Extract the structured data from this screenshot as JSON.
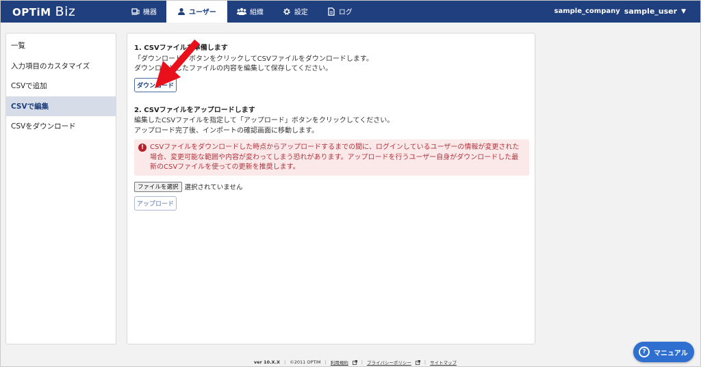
{
  "header": {
    "logo_brand": "OPTiM",
    "logo_product": "Biz",
    "nav": [
      {
        "label": "機器",
        "icon": "device-icon"
      },
      {
        "label": "ユーザー",
        "icon": "user-icon"
      },
      {
        "label": "組織",
        "icon": "organization-icon"
      },
      {
        "label": "設定",
        "icon": "gear-icon"
      },
      {
        "label": "ログ",
        "icon": "log-document-icon"
      }
    ],
    "active_nav": "ユーザー",
    "company": "sample_company",
    "user": "sample_user",
    "colors": {
      "header_bg": "#1f3f7e",
      "accent": "#1f3f7e"
    }
  },
  "sidebar": {
    "items": [
      {
        "label": "一覧"
      },
      {
        "label": "入力項目のカスタマイズ"
      },
      {
        "label": "CSVで追加"
      },
      {
        "label": "CSVで編集"
      },
      {
        "label": "CSVをダウンロード"
      }
    ],
    "active": "CSVで編集"
  },
  "main": {
    "step1": {
      "title": "1. CSVファイルを準備します",
      "line1": "「ダウンロード」ボタンをクリックしてCSVファイルをダウンロードします。",
      "line2": "ダウンロードしたファイルの内容を編集して保存してください。",
      "button": "ダウンロード"
    },
    "step2": {
      "title": "2. CSVファイルをアップロードします",
      "line1": "編集したCSVファイルを指定して「アップロード」ボタンをクリックしてください。",
      "line2": "アップロード完了後、インポートの確認画面に移動します。"
    },
    "alert": {
      "icon": "exclamation-icon",
      "text": "CSVファイルをダウンロードした時点からアップロードするまでの間に、ログインしているユーザーの情報が変更された場合、変更可能な範囲や内容が変わってしまう恐れがあります。アップロードを行うユーザー自身がダウンロードした最新のCSVファイルを使っての更新を推奨します。",
      "color": "#b0333d"
    },
    "file": {
      "button": "ファイルを選択",
      "status": "選択されていません"
    },
    "upload_button": "アップロード"
  },
  "footer": {
    "version": "ver 10.X.X",
    "copyright": "©2011 OPTiM",
    "links": [
      "利用規約",
      "プライバシーポリシー",
      "サイトマップ"
    ]
  },
  "manual_button": {
    "label": "マニュアル",
    "icon": "help-icon"
  }
}
